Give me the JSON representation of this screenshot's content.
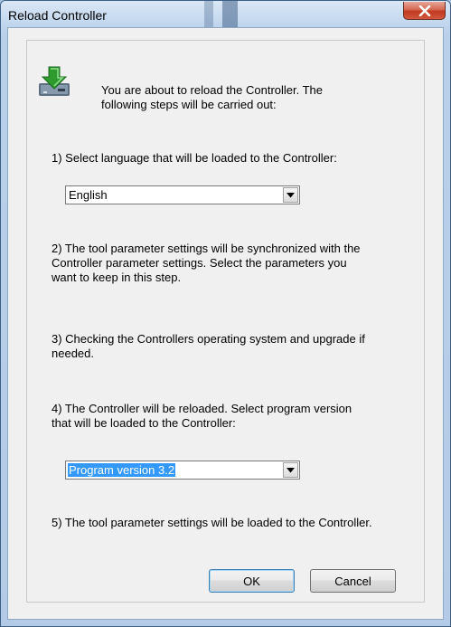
{
  "window": {
    "title": "Reload Controller"
  },
  "intro": "You are about to reload the Controller. The\nfollowing steps will be carried out:",
  "steps": {
    "step1": "1) Select language that will be loaded to the Controller:",
    "step2": "2) The tool parameter settings will be synchronized with the\nController parameter settings. Select the parameters you\nwant to keep in this step.",
    "step3": "3) Checking the Controllers operating system and upgrade if\nneeded.",
    "step4": "4) The Controller will be reloaded. Select program version\nthat will be loaded to the Controller:",
    "step5": "5) The tool parameter settings will be loaded to the Controller."
  },
  "language_select": {
    "value": "English"
  },
  "version_select": {
    "value": "Program version 3.2"
  },
  "buttons": {
    "ok": "OK",
    "cancel": "Cancel"
  },
  "icons": {
    "title_close": "close-icon",
    "reload": "download-arrow-icon",
    "dropdown": "chevron-down-icon"
  },
  "colors": {
    "selection": "#3399ff",
    "close_button": "#c0391f",
    "icon_arrow": "#2e9a2e"
  }
}
